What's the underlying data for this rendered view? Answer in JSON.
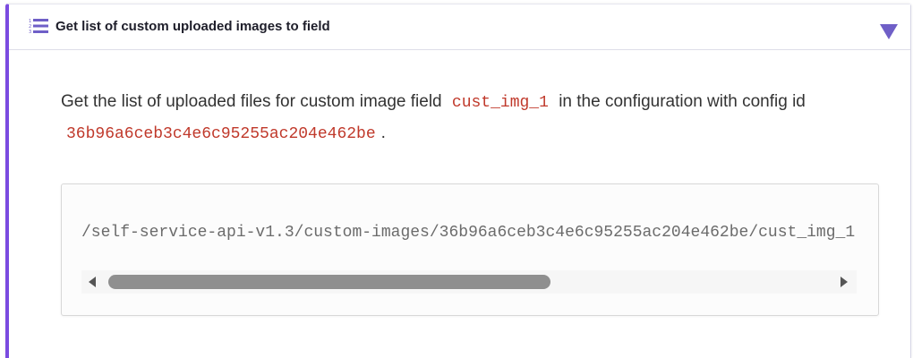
{
  "section": {
    "title": "Get list of custom uploaded images to field",
    "icon": "numbered-list-icon",
    "toggle_icon": "triangle-down-icon",
    "accent_color": "#7b4be0"
  },
  "description": {
    "text_before_field": "Get the list of uploaded files for custom image field",
    "field_name": "cust_img_1",
    "text_middle": "in the configuration with config id",
    "config_id": "36b96a6ceb3c4e6c95255ac204e462be",
    "text_end": "."
  },
  "code_block": {
    "path": "/self-service-api-v1.3/custom-images/36b96a6ceb3c4e6c95255ac204e462be/cust_img_1",
    "scrollbar_position": 0
  }
}
